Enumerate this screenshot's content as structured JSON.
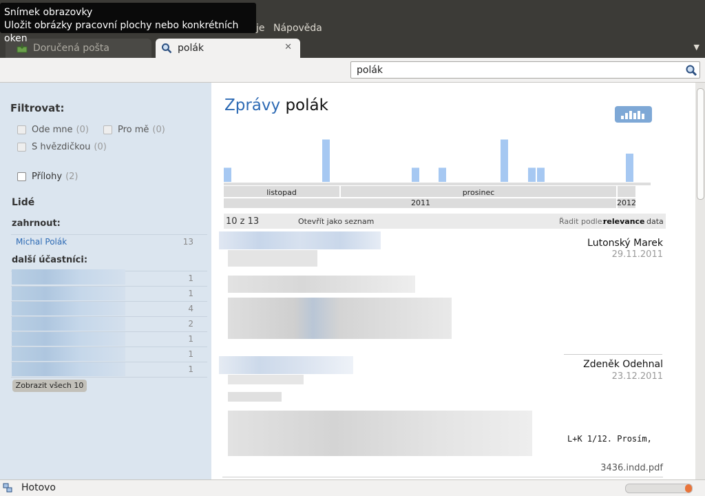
{
  "tooltip": {
    "title": "Snímek obrazovky",
    "description": "Uložit obrázky pracovní plochy nebo konkrétních oken"
  },
  "menu": {
    "partial": "je",
    "help": "Nápověda"
  },
  "tabs": [
    {
      "label": "Doručená pošta",
      "icon": "inbox-icon"
    },
    {
      "label": "polák",
      "icon": "search-icon"
    }
  ],
  "search": {
    "value": "polák"
  },
  "sidebar": {
    "filter_title": "Filtrovat:",
    "from_me": "Ode mne",
    "from_me_count": "(0)",
    "to_me": "Pro mě",
    "to_me_count": "(0)",
    "starred": "S hvězdičkou",
    "starred_count": "(0)",
    "attachments": "Přílohy",
    "attachments_count": "(2)",
    "people_title": "Lidé",
    "include_label": "zahrnout:",
    "included": {
      "name": "Michal Polák",
      "count": "13"
    },
    "others_label": "další účastníci:",
    "others_counts": [
      "1",
      "1",
      "4",
      "2",
      "1",
      "1",
      "1"
    ],
    "show_all": "Zobrazit všech 10"
  },
  "main": {
    "heading_prefix": "Zprávy",
    "heading_query": "polák",
    "timeline": {
      "months": [
        "listopad",
        "prosinec"
      ],
      "years": [
        "2011",
        "2012"
      ]
    },
    "results": {
      "count": "10 z 13",
      "open_list": "Otevřít jako seznam",
      "sort_label": "Řadit podle:",
      "sort_relevance": "relevance",
      "sort_date": "data"
    },
    "messages": [
      {
        "sender": "Lutonský Marek",
        "date": "29.11.2011"
      },
      {
        "sender": "Zdeněk Odehnal",
        "date": "23.12.2011",
        "snippet": "L+K 1/12. Prosím,",
        "attachment": "3436.indd.pdf"
      }
    ]
  },
  "status": {
    "text": "Hotovo"
  },
  "chart_data": {
    "type": "bar",
    "x": [
      "listopad",
      "prosinec"
    ],
    "values": [
      1,
      3,
      1,
      1,
      3,
      1,
      1,
      2
    ],
    "accent": "#a6c8f2"
  }
}
